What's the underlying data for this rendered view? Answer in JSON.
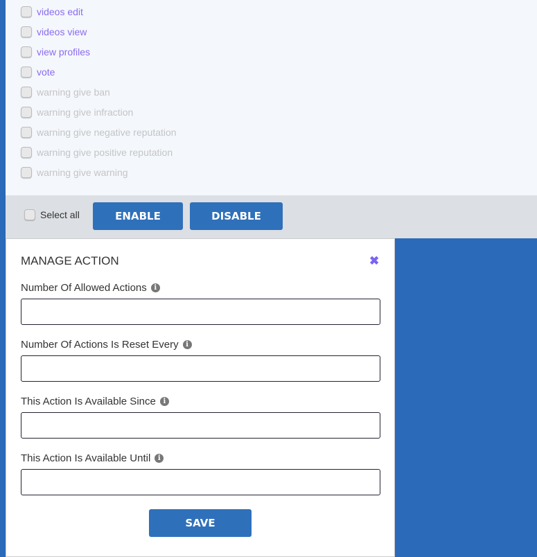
{
  "permissions": [
    {
      "label": "videos edit",
      "enabled": true
    },
    {
      "label": "videos view",
      "enabled": true
    },
    {
      "label": "view profiles",
      "enabled": true
    },
    {
      "label": "vote",
      "enabled": true
    },
    {
      "label": "warning give ban",
      "enabled": false
    },
    {
      "label": "warning give infraction",
      "enabled": false
    },
    {
      "label": "warning give negative reputation",
      "enabled": false
    },
    {
      "label": "warning give positive reputation",
      "enabled": false
    },
    {
      "label": "warning give warning",
      "enabled": false
    }
  ],
  "toolbar": {
    "select_all": "Select all",
    "enable": "ENABLE",
    "disable": "DISABLE"
  },
  "modal": {
    "title": "MANAGE ACTION",
    "close": "✖",
    "save": "SAVE",
    "fields": [
      {
        "label": "Number Of Allowed Actions",
        "value": ""
      },
      {
        "label": "Number Of Actions Is Reset Every",
        "value": ""
      },
      {
        "label": "This Action Is Available Since",
        "value": ""
      },
      {
        "label": "This Action Is Available Until",
        "value": ""
      }
    ]
  }
}
